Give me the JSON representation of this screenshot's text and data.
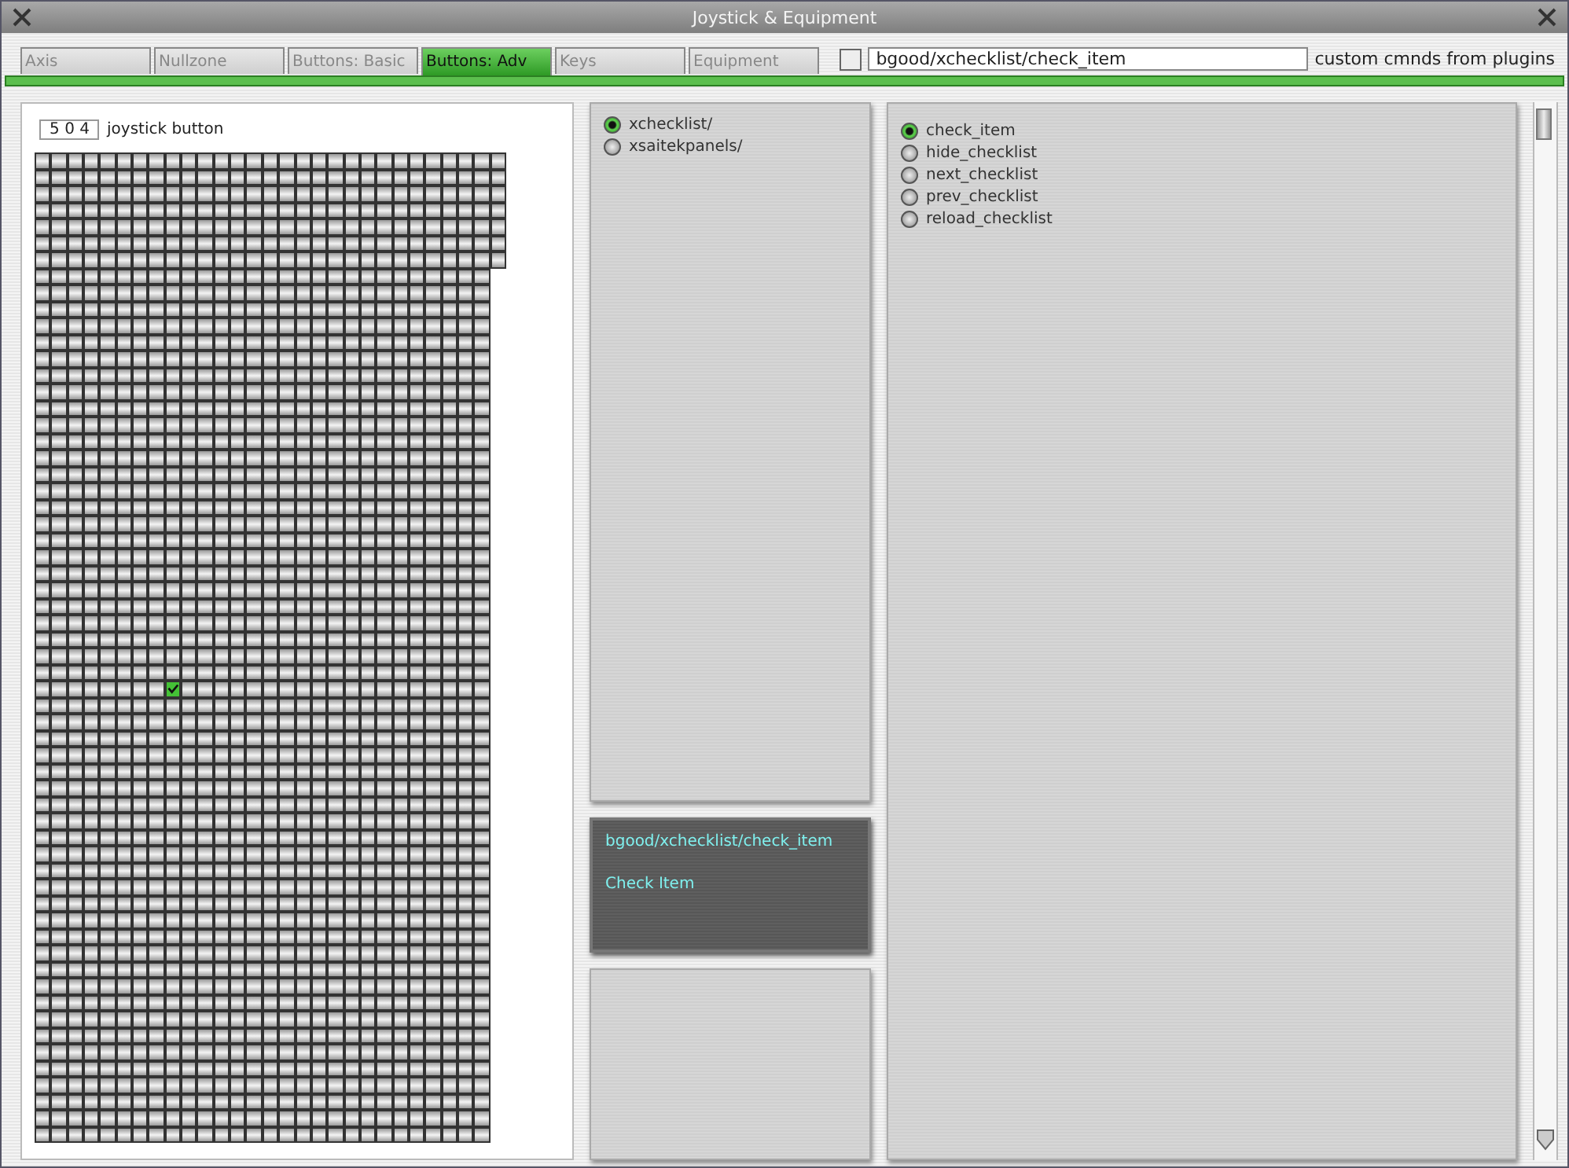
{
  "window": {
    "title": "Joystick & Equipment"
  },
  "tabs": [
    {
      "label": "Axis",
      "selected": false
    },
    {
      "label": "Nullzone",
      "selected": false
    },
    {
      "label": "Buttons: Basic",
      "selected": false
    },
    {
      "label": "Buttons: Adv",
      "selected": true
    },
    {
      "label": "Keys",
      "selected": false
    },
    {
      "label": "Equipment",
      "selected": false
    }
  ],
  "custom_commands": {
    "checked": false,
    "value": "bgood/xchecklist/check_item",
    "label": "custom cmnds from plugins"
  },
  "button_panel": {
    "number": "5 0 4",
    "label": "joystick button",
    "rows": [
      {
        "checked": [
          false,
          false,
          false,
          false,
          false,
          false,
          false,
          false,
          false,
          false,
          false,
          false,
          false,
          false,
          false,
          false,
          false,
          false,
          false,
          false,
          false,
          false,
          false,
          false,
          false,
          false,
          false,
          false,
          false
        ]
      },
      {
        "checked": [
          false,
          false,
          false,
          false,
          false,
          false,
          false,
          false,
          false,
          false,
          false,
          false,
          false,
          false,
          false,
          false,
          false,
          false,
          false,
          false,
          false,
          false,
          false,
          false,
          false,
          false,
          false,
          false,
          false
        ]
      },
      {
        "checked": [
          false,
          false,
          false,
          false,
          false,
          false,
          false,
          false,
          false,
          false,
          false,
          false,
          false,
          false,
          false,
          false,
          false,
          false,
          false,
          false,
          false,
          false,
          false,
          false,
          false,
          false,
          false,
          false,
          false
        ]
      },
      {
        "checked": [
          false,
          false,
          false,
          false,
          false,
          false,
          false,
          false,
          false,
          false,
          false,
          false,
          false,
          false,
          false,
          false,
          false,
          false,
          false,
          false,
          false,
          false,
          false,
          false,
          false,
          false,
          false,
          false,
          false
        ]
      },
      {
        "checked": [
          false,
          false,
          false,
          false,
          false,
          false,
          false,
          false,
          false,
          false,
          false,
          false,
          false,
          false,
          false,
          false,
          false,
          false,
          false,
          false,
          false,
          false,
          false,
          false,
          false,
          false,
          false,
          false,
          false
        ]
      },
      {
        "checked": [
          false,
          false,
          false,
          false,
          false,
          false,
          false,
          false,
          false,
          false,
          false,
          false,
          false,
          false,
          false,
          false,
          false,
          false,
          false,
          false,
          false,
          false,
          false,
          false,
          false,
          false,
          false,
          false,
          false
        ]
      },
      {
        "checked": [
          false,
          false,
          false,
          false,
          false,
          false,
          false,
          false,
          false,
          false,
          false,
          false,
          false,
          false,
          false,
          false,
          false,
          false,
          false,
          false,
          false,
          false,
          false,
          false,
          false,
          false,
          false,
          false,
          false
        ]
      },
      {
        "checked": [
          false,
          false,
          false,
          false,
          false,
          false,
          false,
          false,
          false,
          false,
          false,
          false,
          false,
          false,
          false,
          false,
          false,
          false,
          false,
          false,
          false,
          false,
          false,
          false,
          false,
          false,
          false,
          false
        ]
      },
      {
        "checked": [
          false,
          false,
          false,
          false,
          false,
          false,
          false,
          false,
          false,
          false,
          false,
          false,
          false,
          false,
          false,
          false,
          false,
          false,
          false,
          false,
          false,
          false,
          false,
          false,
          false,
          false,
          false,
          false
        ]
      },
      {
        "checked": [
          false,
          false,
          false,
          false,
          false,
          false,
          false,
          false,
          false,
          false,
          false,
          false,
          false,
          false,
          false,
          false,
          false,
          false,
          false,
          false,
          false,
          false,
          false,
          false,
          false,
          false,
          false,
          false
        ]
      },
      {
        "checked": [
          false,
          false,
          false,
          false,
          false,
          false,
          false,
          false,
          false,
          false,
          false,
          false,
          false,
          false,
          false,
          false,
          false,
          false,
          false,
          false,
          false,
          false,
          false,
          false,
          false,
          false,
          false,
          false
        ]
      },
      {
        "checked": [
          false,
          false,
          false,
          false,
          false,
          false,
          false,
          false,
          false,
          false,
          false,
          false,
          false,
          false,
          false,
          false,
          false,
          false,
          false,
          false,
          false,
          false,
          false,
          false,
          false,
          false,
          false,
          false
        ]
      },
      {
        "checked": [
          false,
          false,
          false,
          false,
          false,
          false,
          false,
          false,
          false,
          false,
          false,
          false,
          false,
          false,
          false,
          false,
          false,
          false,
          false,
          false,
          false,
          false,
          false,
          false,
          false,
          false,
          false,
          false
        ]
      },
      {
        "checked": [
          false,
          false,
          false,
          false,
          false,
          false,
          false,
          false,
          false,
          false,
          false,
          false,
          false,
          false,
          false,
          false,
          false,
          false,
          false,
          false,
          false,
          false,
          false,
          false,
          false,
          false,
          false,
          false
        ]
      },
      {
        "checked": [
          false,
          false,
          false,
          false,
          false,
          false,
          false,
          false,
          false,
          false,
          false,
          false,
          false,
          false,
          false,
          false,
          false,
          false,
          false,
          false,
          false,
          false,
          false,
          false,
          false,
          false,
          false,
          false
        ]
      },
      {
        "checked": [
          false,
          false,
          false,
          false,
          false,
          false,
          false,
          false,
          false,
          false,
          false,
          false,
          false,
          false,
          false,
          false,
          false,
          false,
          false,
          false,
          false,
          false,
          false,
          false,
          false,
          false,
          false,
          false
        ]
      },
      {
        "checked": [
          false,
          false,
          false,
          false,
          false,
          false,
          false,
          false,
          false,
          false,
          false,
          false,
          false,
          false,
          false,
          false,
          false,
          false,
          false,
          false,
          false,
          false,
          false,
          false,
          false,
          false,
          false,
          false
        ]
      },
      {
        "checked": [
          false,
          false,
          false,
          false,
          false,
          false,
          false,
          false,
          false,
          false,
          false,
          false,
          false,
          false,
          false,
          false,
          false,
          false,
          false,
          false,
          false,
          false,
          false,
          false,
          false,
          false,
          false,
          false
        ]
      },
      {
        "checked": [
          false,
          false,
          false,
          false,
          false,
          false,
          false,
          false,
          false,
          false,
          false,
          false,
          false,
          false,
          false,
          false,
          false,
          false,
          false,
          false,
          false,
          false,
          false,
          false,
          false,
          false,
          false,
          false
        ]
      },
      {
        "checked": [
          false,
          false,
          false,
          false,
          false,
          false,
          false,
          false,
          false,
          false,
          false,
          false,
          false,
          false,
          false,
          false,
          false,
          false,
          false,
          false,
          false,
          false,
          false,
          false,
          false,
          false,
          false,
          false
        ]
      },
      {
        "checked": [
          false,
          false,
          false,
          false,
          false,
          false,
          false,
          false,
          false,
          false,
          false,
          false,
          false,
          false,
          false,
          false,
          false,
          false,
          false,
          false,
          false,
          false,
          false,
          false,
          false,
          false,
          false,
          false
        ]
      },
      {
        "checked": [
          false,
          false,
          false,
          false,
          false,
          false,
          false,
          false,
          false,
          false,
          false,
          false,
          false,
          false,
          false,
          false,
          false,
          false,
          false,
          false,
          false,
          false,
          false,
          false,
          false,
          false,
          false,
          false
        ]
      },
      {
        "checked": [
          false,
          false,
          false,
          false,
          false,
          false,
          false,
          false,
          false,
          false,
          false,
          false,
          false,
          false,
          false,
          false,
          false,
          false,
          false,
          false,
          false,
          false,
          false,
          false,
          false,
          false,
          false,
          false
        ]
      },
      {
        "checked": [
          false,
          false,
          false,
          false,
          false,
          false,
          false,
          false,
          false,
          false,
          false,
          false,
          false,
          false,
          false,
          false,
          false,
          false,
          false,
          false,
          false,
          false,
          false,
          false,
          false,
          false,
          false,
          false
        ]
      },
      {
        "checked": [
          false,
          false,
          false,
          false,
          false,
          false,
          false,
          false,
          false,
          false,
          false,
          false,
          false,
          false,
          false,
          false,
          false,
          false,
          false,
          false,
          false,
          false,
          false,
          false,
          false,
          false,
          false,
          false
        ]
      },
      {
        "checked": [
          false,
          false,
          false,
          false,
          false,
          false,
          false,
          false,
          false,
          false,
          false,
          false,
          false,
          false,
          false,
          false,
          false,
          false,
          false,
          false,
          false,
          false,
          false,
          false,
          false,
          false,
          false,
          false
        ]
      },
      {
        "checked": [
          false,
          false,
          false,
          false,
          false,
          false,
          false,
          false,
          false,
          false,
          false,
          false,
          false,
          false,
          false,
          false,
          false,
          false,
          false,
          false,
          false,
          false,
          false,
          false,
          false,
          false,
          false,
          false
        ]
      },
      {
        "checked": [
          false,
          false,
          false,
          false,
          false,
          false,
          false,
          false,
          false,
          false,
          false,
          false,
          false,
          false,
          false,
          false,
          false,
          false,
          false,
          false,
          false,
          false,
          false,
          false,
          false,
          false,
          false,
          false
        ]
      },
      {
        "checked": [
          false,
          false,
          false,
          false,
          false,
          false,
          false,
          false,
          false,
          false,
          false,
          false,
          false,
          false,
          false,
          false,
          false,
          false,
          false,
          false,
          false,
          false,
          false,
          false,
          false,
          false,
          false,
          false
        ]
      },
      {
        "checked": [
          false,
          false,
          false,
          false,
          false,
          false,
          false,
          false,
          false,
          false,
          false,
          false,
          false,
          false,
          false,
          false,
          false,
          false,
          false,
          false,
          false,
          false,
          false,
          false,
          false,
          false,
          false,
          false
        ]
      },
      {
        "checked": [
          false,
          false,
          false,
          false,
          false,
          false,
          false,
          false,
          false,
          false,
          false,
          false,
          false,
          false,
          false,
          false,
          false,
          false,
          false,
          false,
          false,
          false,
          false,
          false,
          false,
          false,
          false,
          false
        ]
      },
      {
        "checked": [
          false,
          false,
          false,
          false,
          false,
          false,
          false,
          false,
          false,
          false,
          false,
          false,
          false,
          false,
          false,
          false,
          false,
          false,
          false,
          false,
          false,
          false,
          false,
          false,
          false,
          false,
          false,
          false
        ]
      },
      {
        "checked": [
          false,
          false,
          false,
          false,
          false,
          false,
          false,
          false,
          true,
          false,
          false,
          false,
          false,
          false,
          false,
          false,
          false,
          false,
          false,
          false,
          false,
          false,
          false,
          false,
          false,
          false,
          false,
          false
        ]
      },
      {
        "checked": [
          false,
          false,
          false,
          false,
          false,
          false,
          false,
          false,
          false,
          false,
          false,
          false,
          false,
          false,
          false,
          false,
          false,
          false,
          false,
          false,
          false,
          false,
          false,
          false,
          false,
          false,
          false,
          false
        ]
      },
      {
        "checked": [
          false,
          false,
          false,
          false,
          false,
          false,
          false,
          false,
          false,
          false,
          false,
          false,
          false,
          false,
          false,
          false,
          false,
          false,
          false,
          false,
          false,
          false,
          false,
          false,
          false,
          false,
          false,
          false
        ]
      },
      {
        "checked": [
          false,
          false,
          false,
          false,
          false,
          false,
          false,
          false,
          false,
          false,
          false,
          false,
          false,
          false,
          false,
          false,
          false,
          false,
          false,
          false,
          false,
          false,
          false,
          false,
          false,
          false,
          false,
          false
        ]
      },
      {
        "checked": [
          false,
          false,
          false,
          false,
          false,
          false,
          false,
          false,
          false,
          false,
          false,
          false,
          false,
          false,
          false,
          false,
          false,
          false,
          false,
          false,
          false,
          false,
          false,
          false,
          false,
          false,
          false,
          false
        ]
      },
      {
        "checked": [
          false,
          false,
          false,
          false,
          false,
          false,
          false,
          false,
          false,
          false,
          false,
          false,
          false,
          false,
          false,
          false,
          false,
          false,
          false,
          false,
          false,
          false,
          false,
          false,
          false,
          false,
          false,
          false
        ]
      },
      {
        "checked": [
          false,
          false,
          false,
          false,
          false,
          false,
          false,
          false,
          false,
          false,
          false,
          false,
          false,
          false,
          false,
          false,
          false,
          false,
          false,
          false,
          false,
          false,
          false,
          false,
          false,
          false,
          false,
          false
        ]
      },
      {
        "checked": [
          false,
          false,
          false,
          false,
          false,
          false,
          false,
          false,
          false,
          false,
          false,
          false,
          false,
          false,
          false,
          false,
          false,
          false,
          false,
          false,
          false,
          false,
          false,
          false,
          false,
          false,
          false,
          false
        ]
      },
      {
        "checked": [
          false,
          false,
          false,
          false,
          false,
          false,
          false,
          false,
          false,
          false,
          false,
          false,
          false,
          false,
          false,
          false,
          false,
          false,
          false,
          false,
          false,
          false,
          false,
          false,
          false,
          false,
          false,
          false
        ]
      },
      {
        "checked": [
          false,
          false,
          false,
          false,
          false,
          false,
          false,
          false,
          false,
          false,
          false,
          false,
          false,
          false,
          false,
          false,
          false,
          false,
          false,
          false,
          false,
          false,
          false,
          false,
          false,
          false,
          false,
          false
        ]
      },
      {
        "checked": [
          false,
          false,
          false,
          false,
          false,
          false,
          false,
          false,
          false,
          false,
          false,
          false,
          false,
          false,
          false,
          false,
          false,
          false,
          false,
          false,
          false,
          false,
          false,
          false,
          false,
          false,
          false,
          false
        ]
      },
      {
        "checked": [
          false,
          false,
          false,
          false,
          false,
          false,
          false,
          false,
          false,
          false,
          false,
          false,
          false,
          false,
          false,
          false,
          false,
          false,
          false,
          false,
          false,
          false,
          false,
          false,
          false,
          false,
          false,
          false
        ]
      },
      {
        "checked": [
          false,
          false,
          false,
          false,
          false,
          false,
          false,
          false,
          false,
          false,
          false,
          false,
          false,
          false,
          false,
          false,
          false,
          false,
          false,
          false,
          false,
          false,
          false,
          false,
          false,
          false,
          false,
          false
        ]
      },
      {
        "checked": [
          false,
          false,
          false,
          false,
          false,
          false,
          false,
          false,
          false,
          false,
          false,
          false,
          false,
          false,
          false,
          false,
          false,
          false,
          false,
          false,
          false,
          false,
          false,
          false,
          false,
          false,
          false,
          false
        ]
      },
      {
        "checked": [
          false,
          false,
          false,
          false,
          false,
          false,
          false,
          false,
          false,
          false,
          false,
          false,
          false,
          false,
          false,
          false,
          false,
          false,
          false,
          false,
          false,
          false,
          false,
          false,
          false,
          false,
          false,
          false
        ]
      },
      {
        "checked": [
          false,
          false,
          false,
          false,
          false,
          false,
          false,
          false,
          false,
          false,
          false,
          false,
          false,
          false,
          false,
          false,
          false,
          false,
          false,
          false,
          false,
          false,
          false,
          false,
          false,
          false,
          false,
          false
        ]
      },
      {
        "checked": [
          false,
          false,
          false,
          false,
          false,
          false,
          false,
          false,
          false,
          false,
          false,
          false,
          false,
          false,
          false,
          false,
          false,
          false,
          false,
          false,
          false,
          false,
          false,
          false,
          false,
          false,
          false,
          false
        ]
      },
      {
        "checked": [
          false,
          false,
          false,
          false,
          false,
          false,
          false,
          false,
          false,
          false,
          false,
          false,
          false,
          false,
          false,
          false,
          false,
          false,
          false,
          false,
          false,
          false,
          false,
          false,
          false,
          false,
          false,
          false
        ]
      },
      {
        "checked": [
          false,
          false,
          false,
          false,
          false,
          false,
          false,
          false,
          false,
          false,
          false,
          false,
          false,
          false,
          false,
          false,
          false,
          false,
          false,
          false,
          false,
          false,
          false,
          false,
          false,
          false,
          false,
          false
        ]
      },
      {
        "checked": [
          false,
          false,
          false,
          false,
          false,
          false,
          false,
          false,
          false,
          false,
          false,
          false,
          false,
          false,
          false,
          false,
          false,
          false,
          false,
          false,
          false,
          false,
          false,
          false,
          false,
          false,
          false,
          false
        ]
      },
      {
        "checked": [
          false,
          false,
          false,
          false,
          false,
          false,
          false,
          false,
          false,
          false,
          false,
          false,
          false,
          false,
          false,
          false,
          false,
          false,
          false,
          false,
          false,
          false,
          false,
          false,
          false,
          false,
          false,
          false
        ]
      },
      {
        "checked": [
          false,
          false,
          false,
          false,
          false,
          false,
          false,
          false,
          false,
          false,
          false,
          false,
          false,
          false,
          false,
          false,
          false,
          false,
          false,
          false,
          false,
          false,
          false,
          false,
          false,
          false,
          false,
          false
        ]
      },
      {
        "checked": [
          false,
          false,
          false,
          false,
          false,
          false,
          false,
          false,
          false,
          false,
          false,
          false,
          false,
          false,
          false,
          false,
          false,
          false,
          false,
          false,
          false,
          false,
          false,
          false,
          false,
          false,
          false,
          false
        ]
      },
      {
        "checked": [
          false,
          false,
          false,
          false,
          false,
          false,
          false,
          false,
          false,
          false,
          false,
          false,
          false,
          false,
          false,
          false,
          false,
          false,
          false,
          false,
          false,
          false,
          false,
          false,
          false,
          false,
          false,
          false
        ]
      },
      {
        "checked": [
          false,
          false,
          false,
          false,
          false,
          false,
          false,
          false,
          false,
          false,
          false,
          false,
          false,
          false,
          false,
          false,
          false,
          false,
          false,
          false,
          false,
          false,
          false,
          false,
          false,
          false,
          false,
          false
        ]
      },
      {
        "checked": [
          false,
          false,
          false,
          false,
          false,
          false,
          false,
          false,
          false,
          false,
          false,
          false,
          false,
          false,
          false,
          false,
          false,
          false,
          false,
          false,
          false,
          false,
          false,
          false,
          false,
          false,
          false,
          false
        ]
      },
      {
        "checked": [
          false,
          false,
          false,
          false,
          false,
          false,
          false,
          false,
          false,
          false,
          false,
          false,
          false,
          false,
          false,
          false,
          false,
          false,
          false,
          false,
          false,
          false,
          false,
          false,
          false,
          false,
          false,
          false
        ]
      },
      {
        "checked": [
          false,
          false,
          false,
          false,
          false,
          false,
          false,
          false,
          false,
          false,
          false,
          false,
          false,
          false,
          false,
          false,
          false,
          false,
          false,
          false,
          false,
          false,
          false,
          false,
          false,
          false,
          false,
          false
        ]
      }
    ]
  },
  "folders": [
    {
      "label": "xchecklist/",
      "selected": true
    },
    {
      "label": "xsaitekpanels/",
      "selected": false
    }
  ],
  "description": {
    "command": "bgood/xchecklist/check_item",
    "text": "Check Item"
  },
  "commands": [
    {
      "label": "check_item",
      "selected": true
    },
    {
      "label": "hide_checklist",
      "selected": false
    },
    {
      "label": "next_checklist",
      "selected": false
    },
    {
      "label": "prev_checklist",
      "selected": false
    },
    {
      "label": "reload_checklist",
      "selected": false
    }
  ]
}
